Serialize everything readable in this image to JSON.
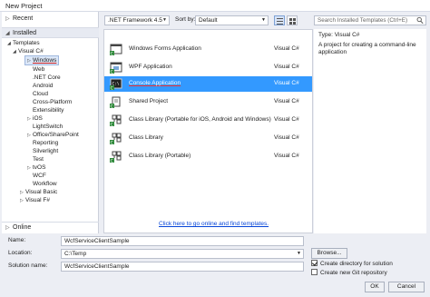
{
  "window": {
    "title": "New Project"
  },
  "left": {
    "recent": "Recent",
    "installed": "Installed",
    "online": "Online",
    "tree": [
      {
        "label": "Templates",
        "toggle": "◢"
      },
      {
        "label": "Visual C#",
        "toggle": "◢"
      },
      {
        "label": "Windows",
        "toggle": "▷"
      },
      {
        "label": "Web",
        "toggle": ""
      },
      {
        "label": ".NET Core",
        "toggle": ""
      },
      {
        "label": "Android",
        "toggle": ""
      },
      {
        "label": "Cloud",
        "toggle": ""
      },
      {
        "label": "Cross-Platform",
        "toggle": ""
      },
      {
        "label": "Extensibility",
        "toggle": ""
      },
      {
        "label": "iOS",
        "toggle": "▷"
      },
      {
        "label": "LightSwitch",
        "toggle": ""
      },
      {
        "label": "Office/SharePoint",
        "toggle": "▷"
      },
      {
        "label": "Reporting",
        "toggle": ""
      },
      {
        "label": "Silverlight",
        "toggle": ""
      },
      {
        "label": "Test",
        "toggle": ""
      },
      {
        "label": "tvOS",
        "toggle": "▷"
      },
      {
        "label": "WCF",
        "toggle": ""
      },
      {
        "label": "Workflow",
        "toggle": ""
      },
      {
        "label": "Visual Basic",
        "toggle": "▷"
      },
      {
        "label": "Visual F#",
        "toggle": "▷"
      }
    ]
  },
  "toolbar": {
    "framework": ".NET Framework 4.5",
    "sort_label": "Sort by:",
    "sort_value": "Default",
    "search_placeholder": "Search Installed Templates (Ctrl+E)"
  },
  "templates": [
    {
      "name": "Windows Forms Application",
      "lang": "Visual C#"
    },
    {
      "name": "WPF Application",
      "lang": "Visual C#"
    },
    {
      "name": "Console Application",
      "lang": "Visual C#"
    },
    {
      "name": "Shared Project",
      "lang": "Visual C#"
    },
    {
      "name": "Class Library (Portable for iOS, Android and Windows)",
      "lang": "Visual C#"
    },
    {
      "name": "Class Library",
      "lang": "Visual C#"
    },
    {
      "name": "Class Library (Portable)",
      "lang": "Visual C#"
    }
  ],
  "online_link": "Click here to go online and find templates.",
  "description": {
    "type_label": "Type:",
    "type_value": "Visual C#",
    "text": "A project for creating a command-line application"
  },
  "form": {
    "name_label": "Name:",
    "name_value": "WcfServiceClientSample",
    "location_label": "Location:",
    "location_value": "C:\\Temp",
    "solution_label": "Solution name:",
    "solution_value": "WcfServiceClientSample",
    "browse": "Browse...",
    "create_dir": "Create directory for solution",
    "create_git": "Create new Git repository",
    "ok": "OK",
    "cancel": "Cancel"
  },
  "colors": {
    "selection": "#3399ff",
    "link": "#0645d8"
  }
}
